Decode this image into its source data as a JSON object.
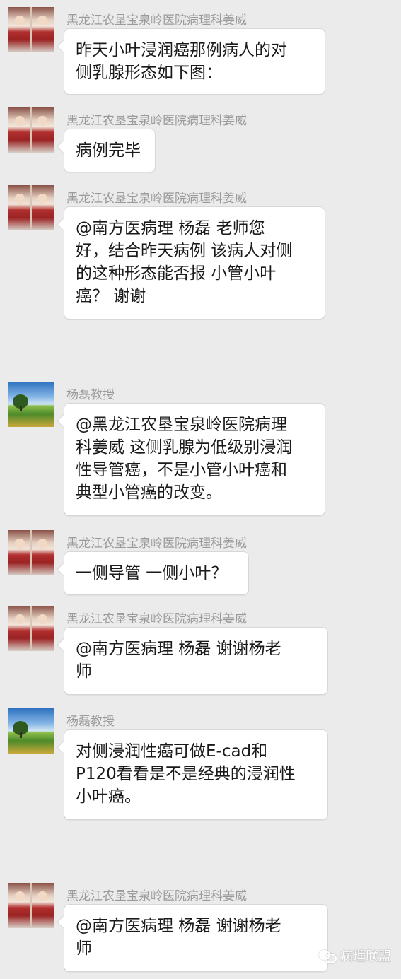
{
  "messages": [
    {
      "sender": "黑龙江农垦宝泉岭医院病理科姜威",
      "avatar": "child-photo-avatar",
      "lines": [
        "昨天小叶浸润癌那例病人的对",
        "侧乳腺形态如下图："
      ]
    },
    {
      "sender": "黑龙江农垦宝泉岭医院病理科姜威",
      "avatar": "child-photo-avatar",
      "lines": [
        "病例完毕"
      ]
    },
    {
      "sender": "黑龙江农垦宝泉岭医院病理科姜威",
      "avatar": "child-photo-avatar",
      "lines": [
        "@南方医病理 杨磊  老师您",
        "好，结合昨天病例 该病人对侧",
        "的这种形态能否报 小管小叶",
        "癌？ 谢谢"
      ]
    },
    {
      "sender": "杨磊教授",
      "avatar": "landscape-avatar",
      "lines": [
        "@黑龙江农垦宝泉岭医院病理",
        "科姜威 这侧乳腺为低级别浸润",
        "性导管癌，不是小管小叶癌和",
        "典型小管癌的改变。"
      ]
    },
    {
      "sender": "黑龙江农垦宝泉岭医院病理科姜威",
      "avatar": "child-photo-avatar",
      "lines": [
        "一侧导管 一侧小叶？"
      ]
    },
    {
      "sender": "黑龙江农垦宝泉岭医院病理科姜威",
      "avatar": "child-photo-avatar",
      "lines": [
        "@南方医病理 杨磊  谢谢杨老",
        "师"
      ]
    },
    {
      "sender": "杨磊教授",
      "avatar": "landscape-avatar",
      "lines": [
        "对侧浸润性癌可做E-cad和",
        "P120看看是不是经典的浸润性",
        "小叶癌。"
      ]
    },
    {
      "sender": "黑龙江农垦宝泉岭医院病理科姜威",
      "avatar": "child-photo-avatar",
      "lines": [
        "@南方医病理 杨磊  谢谢杨老",
        "师"
      ]
    }
  ],
  "watermark": {
    "text": "病理联盟",
    "icon": "wechat-icon"
  },
  "colors": {
    "background": "#ebebeb",
    "bubble": "#ffffff",
    "sender_name": "#9a9a9a",
    "text": "#1a1a1a"
  }
}
